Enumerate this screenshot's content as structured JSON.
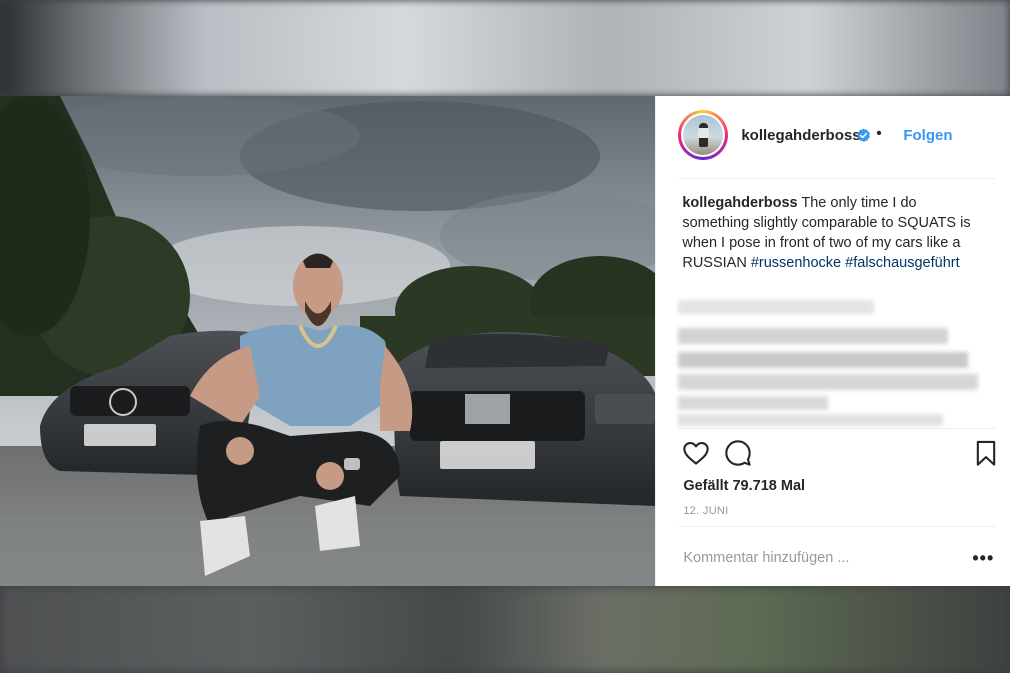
{
  "post": {
    "username": "kollegahderboss",
    "verified_icon": "verified-badge-icon",
    "separator": "•",
    "follow_label": "Folgen",
    "caption": {
      "username": "kollegahderboss",
      "text": "The only time I do something slightly comparable to SQUATS is when I pose in front of two of my cars like a RUSSIAN",
      "hashtag1": "#russenhocke",
      "hashtag2": "#falschausgeführt"
    },
    "likes": "Gefällt 79.718 Mal",
    "date": "12. JUNI",
    "comment_placeholder": "Kommentar hinzufügen ...",
    "more_label": "•••",
    "icons": {
      "like": "heart-icon",
      "comment": "comment-icon",
      "save": "bookmark-icon"
    }
  },
  "colors": {
    "link_blue": "#3897f0",
    "text": "#262626",
    "muted": "#999999",
    "verified": "#3897f0"
  }
}
